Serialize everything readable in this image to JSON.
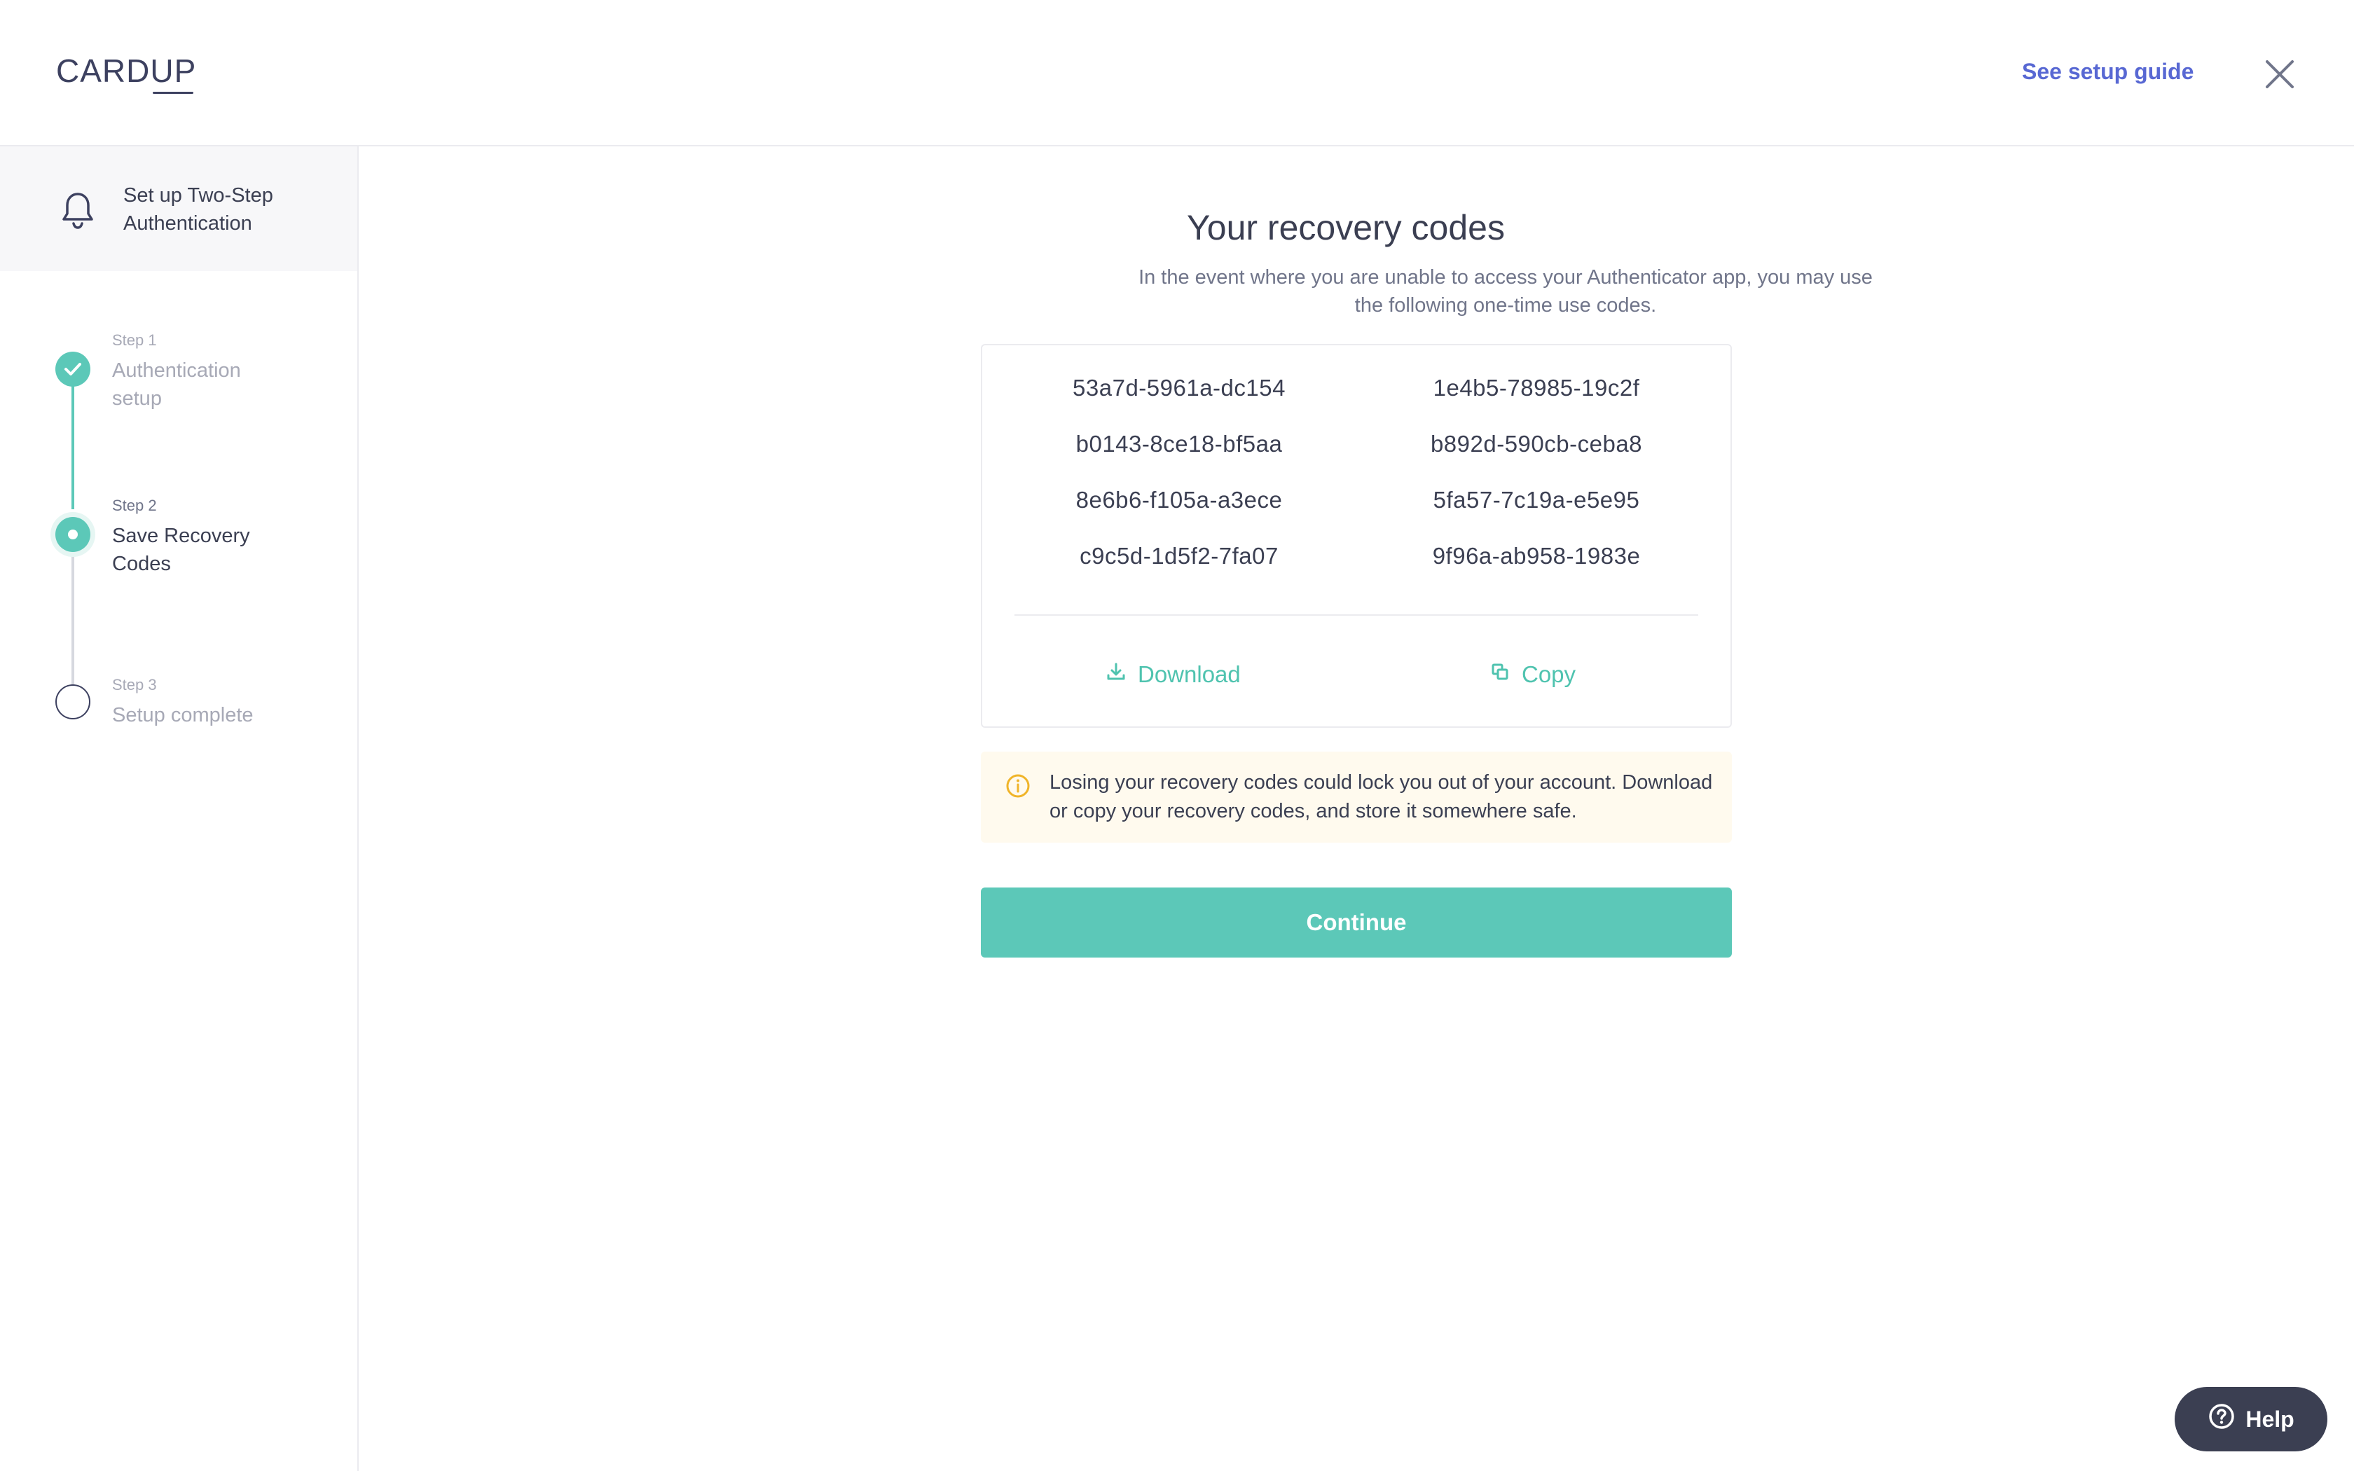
{
  "header": {
    "logo_text_1": "CARD",
    "logo_text_2": "UP",
    "guide_link": "See setup guide"
  },
  "sidebar": {
    "title": "Set up Two-Step Authentication",
    "steps": [
      {
        "step_label": "Step 1",
        "label": "Authentication setup",
        "state": "complete"
      },
      {
        "step_label": "Step 2",
        "label": "Save Recovery Codes",
        "state": "current"
      },
      {
        "step_label": "Step 3",
        "label": "Setup complete",
        "state": "pending"
      }
    ]
  },
  "main": {
    "title": "Your recovery codes",
    "subtitle": "In the event where you are unable to access your Authenticator app, you may use the following one-time use codes.",
    "codes": [
      "53a7d-5961a-dc154",
      "1e4b5-78985-19c2f",
      "b0143-8ce18-bf5aa",
      "b892d-590cb-ceba8",
      "8e6b6-f105a-a3ece",
      "5fa57-7c19a-e5e95",
      "c9c5d-1d5f2-7fa07",
      "9f96a-ab958-1983e"
    ],
    "download_label": "Download",
    "copy_label": "Copy",
    "warning": "Losing your recovery codes could lock you out of your account. Download or copy your recovery codes, and store it somewhere safe.",
    "continue_label": "Continue"
  },
  "help": {
    "label": "Help"
  },
  "colors": {
    "accent": "#5cc8b8",
    "link": "#5868d3",
    "warning_bg": "#fffaee",
    "warning_icon": "#f0b429"
  }
}
